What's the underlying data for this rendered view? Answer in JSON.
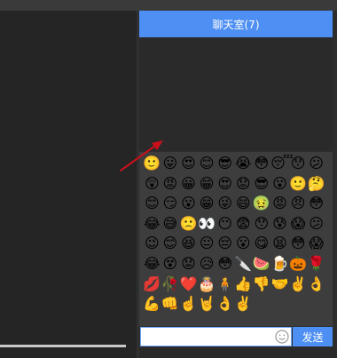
{
  "chat": {
    "title": "聊天室(7)",
    "send_label": "发送",
    "input_value": ""
  },
  "emoji_panel": {
    "emojis": [
      "🙂",
      "😛",
      "😍",
      "😊",
      "😎",
      "😭",
      "😳",
      "😴",
      "😯",
      "😕",
      "😲",
      "😡",
      "😀",
      "😁",
      "😍",
      "😟",
      "😎",
      "😮",
      "🙂",
      "🤔",
      "😊",
      "😏",
      "😮",
      "😁",
      "😜",
      "😄",
      "🤢",
      "😡",
      "😠",
      "😳",
      "😂",
      "😅",
      "🙁",
      "👀",
      "😶",
      "😨",
      "😯",
      "😰",
      "😱",
      "😕",
      "😉",
      "😊",
      "😆",
      "😐",
      "😔",
      "😮",
      "😋",
      "😫",
      "😳",
      "😱",
      "😂",
      "😵",
      "😟",
      "😥",
      "😳",
      "🔪",
      "🍉",
      "🍺",
      "🎃",
      "🌹",
      "💋",
      "🥀",
      "❤️",
      "🎂",
      "🧍",
      "👍",
      "👎",
      "🤝",
      "✌️",
      "👌",
      "💪",
      "👊",
      "☝️",
      "🤘",
      "👌",
      "✌️"
    ]
  },
  "colors": {
    "accent": "#4e8ff3",
    "annotation_arrow": "#c8101c"
  },
  "icons": {
    "emoji_toggle": "smile-icon"
  }
}
